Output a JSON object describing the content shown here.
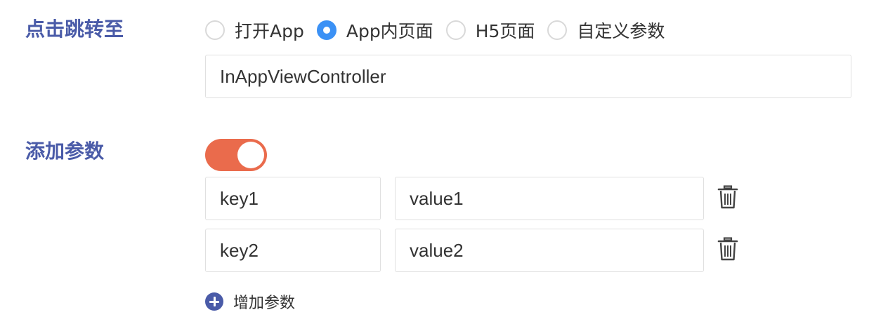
{
  "jump": {
    "label": "点击跳转至",
    "options": [
      {
        "label": "打开App",
        "checked": false
      },
      {
        "label": "App内页面",
        "checked": true
      },
      {
        "label": "H5页面",
        "checked": false
      },
      {
        "label": "自定义参数",
        "checked": false
      }
    ],
    "controller_value": "InAppViewController"
  },
  "params": {
    "label": "添加参数",
    "toggle_on": true,
    "toggle_color": "#ea6b4c",
    "rows": [
      {
        "key": "key1",
        "value": "value1"
      },
      {
        "key": "key2",
        "value": "value2"
      }
    ],
    "add_label": "增加参数"
  },
  "colors": {
    "label": "#4a5ba8",
    "radio_checked": "#3b91f5",
    "add_icon": "#4a5ba8"
  },
  "icons": {
    "delete": "trash-icon",
    "add": "plus-circle-icon"
  }
}
